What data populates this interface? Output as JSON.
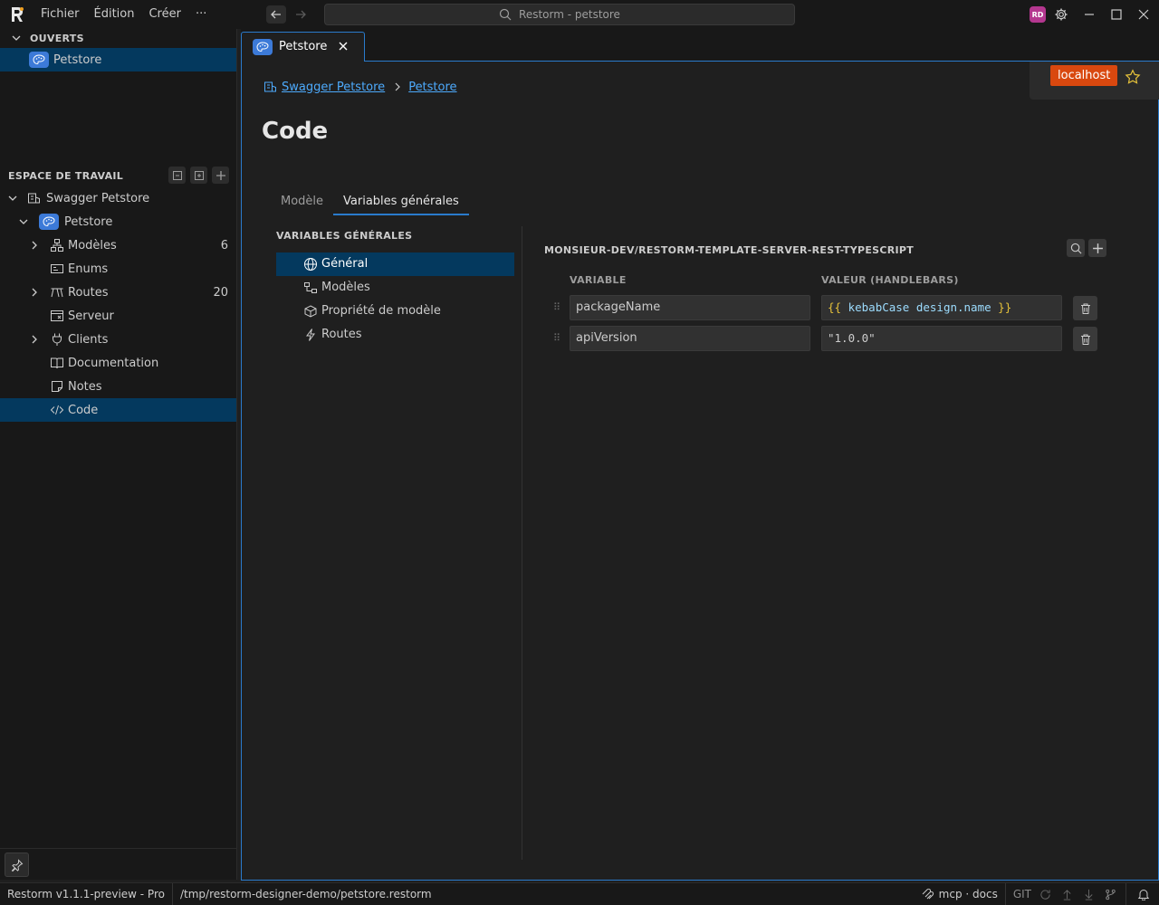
{
  "menu": {
    "file": "Fichier",
    "edit": "Édition",
    "create": "Créer",
    "more": "···"
  },
  "search": {
    "text": "Restorm - petstore"
  },
  "user": {
    "initials": "RD"
  },
  "sidebar": {
    "opened_header": "OUVERTS",
    "opened_items": [
      {
        "label": "Petstore"
      }
    ],
    "workspace_header": "ESPACE DE TRAVAIL",
    "tree": {
      "root": "Swagger Petstore",
      "project": "Petstore",
      "items": [
        {
          "label": "Modèles",
          "count": "6",
          "icon": "models-icon"
        },
        {
          "label": "Enums",
          "count": "",
          "icon": "enums-icon"
        },
        {
          "label": "Routes",
          "count": "20",
          "icon": "routes-icon"
        },
        {
          "label": "Serveur",
          "count": "",
          "icon": "server-icon"
        },
        {
          "label": "Clients",
          "count": "",
          "icon": "clients-icon"
        },
        {
          "label": "Documentation",
          "count": "",
          "icon": "book-icon"
        },
        {
          "label": "Notes",
          "count": "",
          "icon": "note-icon"
        },
        {
          "label": "Code",
          "count": "",
          "icon": "code-icon"
        }
      ]
    }
  },
  "tab": {
    "label": "Petstore"
  },
  "breadcrumb": {
    "root": "Swagger Petstore",
    "current": "Petstore"
  },
  "env": {
    "label": "localhost"
  },
  "page": {
    "title": "Code",
    "tabs": [
      {
        "label": "Modèle"
      },
      {
        "label": "Variables générales"
      }
    ]
  },
  "left_nav": {
    "title": "VARIABLES GÉNÉRALES",
    "items": [
      {
        "label": "Général",
        "icon": "globe-icon"
      },
      {
        "label": "Modèles",
        "icon": "models-icon"
      },
      {
        "label": "Propriété de modèle",
        "icon": "box-icon"
      },
      {
        "label": "Routes",
        "icon": "bolt-icon"
      }
    ]
  },
  "variables": {
    "title": "MONSIEUR-DEV/RESTORM-TEMPLATE-SERVER-REST-TYPESCRIPT",
    "col_variable": "VARIABLE",
    "col_value": "VALEUR (HANDLEBARS)",
    "rows": [
      {
        "name": "packageName",
        "value_open": "{{",
        "value_body": "kebabCase design.name",
        "value_close": "}}"
      },
      {
        "name": "apiVersion",
        "value": "\"1.0.0\""
      }
    ]
  },
  "status": {
    "version": "Restorm v1.1.1-preview - Pro",
    "path": "/tmp/restorm-designer-demo/petstore.restorm",
    "mcp": "mcp · docs",
    "git": "GIT"
  }
}
